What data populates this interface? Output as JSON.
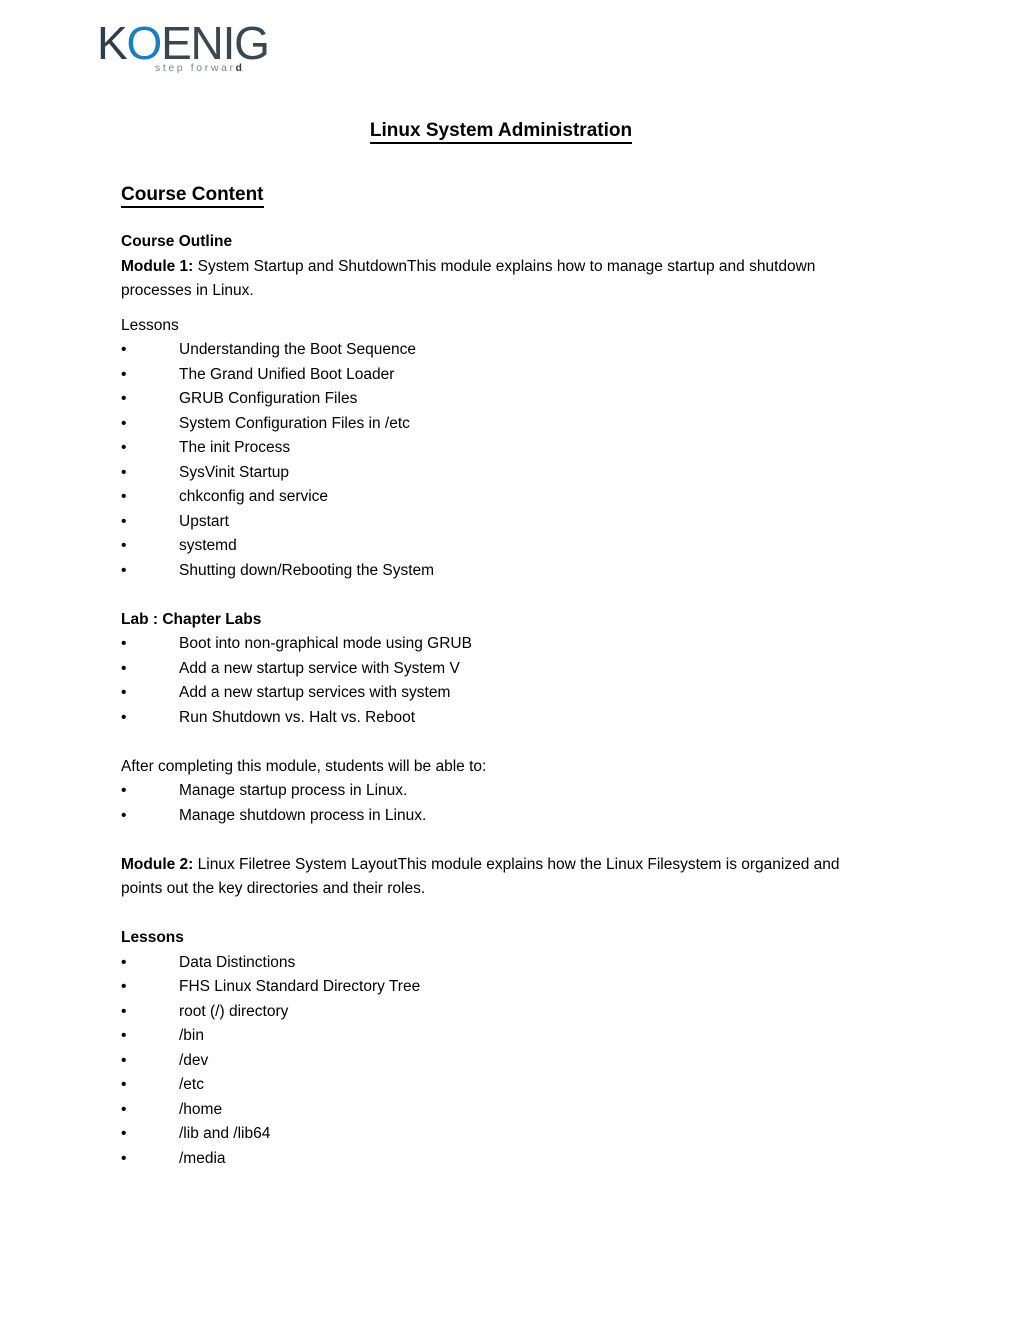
{
  "logo": {
    "word_part1": "K",
    "word_part2": "O",
    "word_part3": "ENIG",
    "tagline": "step forwar",
    "tagline_last": "d",
    "color_blue": "#1a7fc1",
    "color_dark": "#3b4750",
    "color_tagline": "#7d858b"
  },
  "document": {
    "title": "Linux System Administration",
    "section_heading": "Course Content",
    "course_outline_label": "Course Outline",
    "module1": {
      "label": "Module 1:",
      "text": " System Startup and ShutdownThis module explains how to manage startup and shutdown processes in Linux."
    },
    "lessons1_label": "Lessons",
    "lessons1": [
      "Understanding the Boot Sequence",
      "The Grand Unified Boot Loader",
      "GRUB Configuration Files",
      "System Configuration Files in /etc",
      "The init Process",
      "SysVinit Startup",
      "chkconfig and service",
      "Upstart",
      "systemd",
      "Shutting down/Rebooting the System"
    ],
    "lab_label": "Lab : Chapter Labs",
    "labs": [
      "Boot into non-graphical mode using GRUB",
      "Add a new startup service with System V",
      "Add a new startup services with system",
      "Run Shutdown vs. Halt vs. Reboot"
    ],
    "objectives_intro": "After completing this module, students will be able to:",
    "objectives": [
      "Manage startup process in Linux.",
      "Manage shutdown process in Linux."
    ],
    "module2": {
      "label": "Module 2:",
      "text": " Linux Filetree System LayoutThis module explains how the Linux Filesystem is organized and points out the key directories and their roles."
    },
    "lessons2_label": "Lessons",
    "lessons2": [
      "Data Distinctions",
      "FHS Linux Standard Directory Tree",
      "root (/) directory",
      "/bin",
      "/dev",
      "/etc",
      "/home",
      "/lib and /lib64",
      "/media"
    ],
    "bullet_glyph": "•"
  }
}
